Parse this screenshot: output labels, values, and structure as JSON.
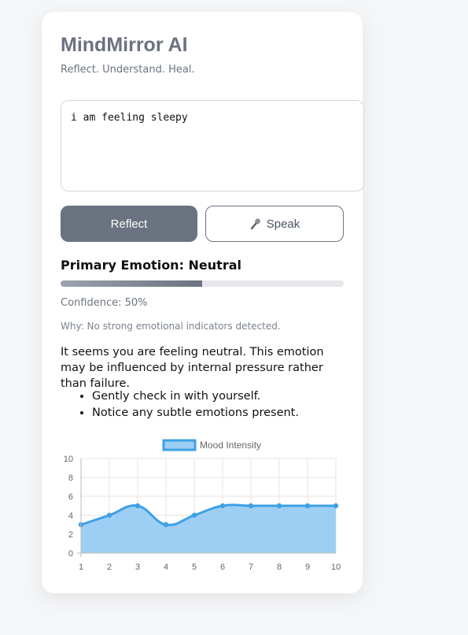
{
  "app": {
    "title": "MindMirror AI",
    "tagline": "Reflect. Understand. Heal."
  },
  "entry": {
    "value": "i am feeling sleepy"
  },
  "buttons": {
    "reflect": "Reflect",
    "speak": "Speak",
    "speak_icon": "microphone-icon"
  },
  "analysis": {
    "primary_emotion": "Primary Emotion: Neutral",
    "confidence_value": 0.5,
    "confidence_label": "Confidence: 50%",
    "why": "Why: No strong emotional indicators detected.",
    "message": "It seems you are feeling neutral. This emotion may be influenced by internal pressure rather than failure.",
    "tips": [
      "Gently check in with yourself.",
      "Notice any subtle emotions present."
    ]
  },
  "colors": {
    "accent": "#6b7280",
    "series_line": "#3ea0e6",
    "series_fill": "#9dcff4"
  },
  "chart_data": {
    "type": "area",
    "x": [
      1,
      2,
      3,
      4,
      5,
      6,
      7,
      8,
      9,
      10
    ],
    "series": [
      {
        "name": "Mood Intensity",
        "values": [
          3,
          4,
          5,
          3,
          4,
          5,
          5,
          5,
          5,
          5
        ]
      }
    ],
    "xlim": [
      1,
      10
    ],
    "ylim": [
      0,
      10
    ],
    "yticks": [
      0,
      2,
      4,
      6,
      8,
      10
    ],
    "grid": true,
    "legend": "top-center"
  }
}
